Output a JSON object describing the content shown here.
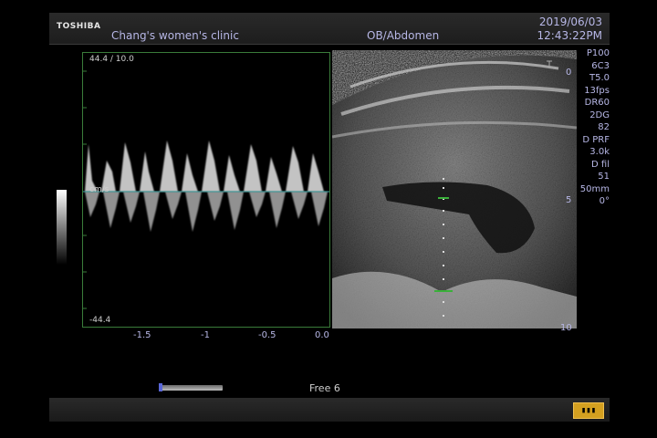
{
  "header": {
    "brand": "TOSHIBA",
    "clinic": "Chang's women's clinic",
    "mode": "OB/Abdomen",
    "date": "2019/06/03",
    "time": "12:43:22PM"
  },
  "doppler": {
    "scale_top": "44.4 / 10.0",
    "scale_bottom": "-44.4",
    "unit": "cm/s",
    "x_ticks": [
      "-1.5",
      "-1",
      "-0.5",
      "0.0"
    ]
  },
  "params": [
    "P100",
    "6C3",
    "T5.0",
    "13fps",
    "DR60",
    "2DG",
    "82",
    "D PRF",
    "3.0k",
    "D fil",
    "51",
    "50mm",
    "0°"
  ],
  "depth_marks": {
    "top": "0",
    "mid": "5",
    "bottom": "10"
  },
  "footer": {
    "freeze_label": "Free 6",
    "cine_icon": "cine-loop-icon",
    "freeze_position": 0.02
  },
  "colors": {
    "accent_text": "#b7b7e6",
    "doppler_border": "#3a7c3a",
    "cine_button": "#d4a020"
  }
}
